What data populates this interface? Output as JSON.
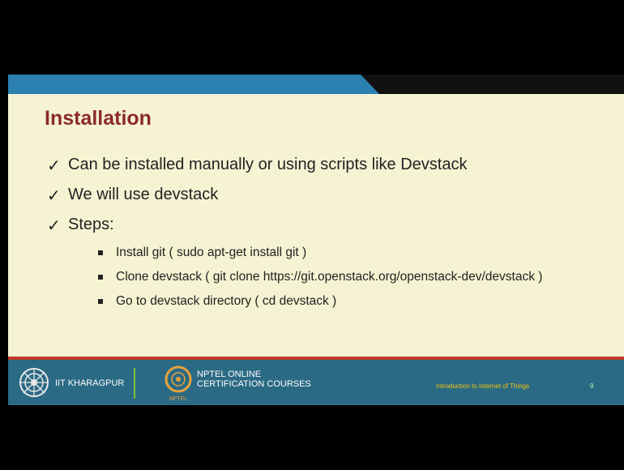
{
  "slide": {
    "title": "Installation",
    "bullets": [
      "Can be installed manually or using scripts like Devstack",
      "We will use devstack",
      "Steps:"
    ],
    "steps": [
      "Install git ( sudo apt-get install git )",
      "Clone devstack ( git clone https://git.openstack.org/openstack-dev/devstack )",
      "Go to devstack directory ( cd devstack )"
    ]
  },
  "footer": {
    "institute": "IIT KHARAGPUR",
    "nptel_line1": "NPTEL ONLINE",
    "nptel_line2": "CERTIFICATION COURSES",
    "nptel_small": "NPTEL",
    "course": "Introduction to Internet of Things",
    "page": "9"
  },
  "colors": {
    "title": "#8b2a2a",
    "footer": "#2b6a84",
    "accent": "#c0392b",
    "top_band": "#2c7fb1"
  }
}
